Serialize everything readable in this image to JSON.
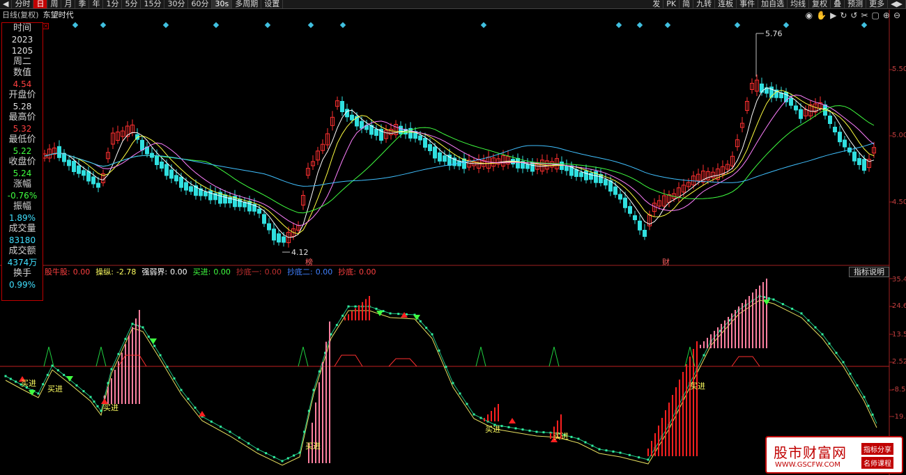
{
  "toolbar": {
    "left_items": [
      "分时",
      "日",
      "周",
      "月",
      "季",
      "年",
      "1分",
      "5分",
      "15分",
      "30分",
      "60分",
      "30s",
      "多周期",
      "设置"
    ],
    "active_item": "日",
    "right_items": [
      "发",
      "PK",
      "简",
      "九转",
      "连板",
      "事件",
      "加自选",
      "均线",
      "复权",
      "叠",
      "预测",
      "更多"
    ]
  },
  "header": {
    "period_label": "日线(复权)",
    "stock_name": "东望时代"
  },
  "info_panel": {
    "rows": [
      {
        "label": "时间",
        "value": "2023",
        "tone": "white"
      },
      {
        "label": "",
        "value": "1205",
        "tone": "white"
      },
      {
        "label": "周二",
        "value": "",
        "tone": "white"
      },
      {
        "label": "数值",
        "value": "4.54",
        "tone": "red"
      },
      {
        "label": "开盘价",
        "value": "5.28",
        "tone": "white"
      },
      {
        "label": "最高价",
        "value": "5.32",
        "tone": "red"
      },
      {
        "label": "最低价",
        "value": "5.22",
        "tone": "green"
      },
      {
        "label": "收盘价",
        "value": "5.24",
        "tone": "green"
      },
      {
        "label": "涨幅",
        "value": "-0.76%",
        "tone": "green"
      },
      {
        "label": "振幅",
        "value": "1.89%",
        "tone": "cyan"
      },
      {
        "label": "成交量",
        "value": "83180",
        "tone": "cyan"
      },
      {
        "label": "成交额",
        "value": "4374万",
        "tone": "cyan"
      },
      {
        "label": "换手",
        "value": "0.99%",
        "tone": "cyan"
      }
    ]
  },
  "price_chart": {
    "y_ticks": [
      "5.50",
      "5.00",
      "4.50"
    ],
    "high_label": "5.76",
    "low_label": "4.12",
    "event_labels": [
      "榜",
      "财"
    ]
  },
  "indicator": {
    "legend": [
      {
        "name": "股牛股:",
        "value": "0.00",
        "color": "#ff4040"
      },
      {
        "name": "操纵:",
        "value": "-2.78",
        "color": "#ffff60"
      },
      {
        "name": "强弱界:",
        "value": "0.00",
        "color": "#ffffff"
      },
      {
        "name": "买进:",
        "value": "0.00",
        "color": "#40ff40"
      },
      {
        "name": "抄底一:",
        "value": "0.00",
        "color": "#c03030"
      },
      {
        "name": "抄底二:",
        "value": "0.00",
        "color": "#4080ff"
      },
      {
        "name": "抄底:",
        "value": "0.00",
        "color": "#ff4040"
      }
    ],
    "help_button": "指标说明",
    "y_ticks": [
      "35.4",
      "24.6",
      "13.5",
      "2.52",
      "-8.5",
      "-19."
    ],
    "buy_label": "买进"
  },
  "watermark": {
    "main": "股市财富网",
    "url": "WWW.GSCFW.COM",
    "tag1": "指标分享",
    "tag2": "名师课程"
  },
  "colors": {
    "up": "#ff3030",
    "down": "#30e0e0",
    "ma5": "#ffffff",
    "ma10": "#ffff40",
    "ma20": "#ff80ff",
    "ma30": "#40ff40",
    "ma60": "#40c0ff"
  }
}
